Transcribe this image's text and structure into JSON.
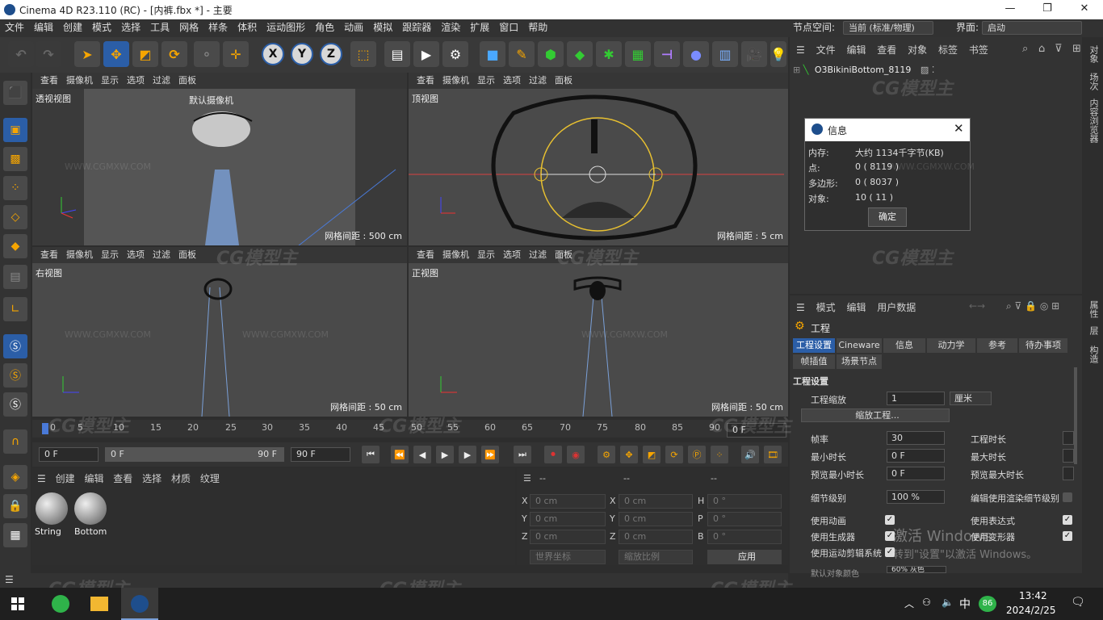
{
  "window": {
    "title": "Cinema 4D R23.110 (RC) - [内裤.fbx *] - 主要"
  },
  "menu": [
    "文件",
    "编辑",
    "创建",
    "模式",
    "选择",
    "工具",
    "网格",
    "样条",
    "体积",
    "运动图形",
    "角色",
    "动画",
    "模拟",
    "跟踪器",
    "渲染",
    "扩展",
    "窗口",
    "帮助"
  ],
  "node_space": {
    "label": "节点空间:",
    "value": "当前 (标准/物理)"
  },
  "layout": {
    "label": "界面:",
    "value": "启动"
  },
  "viewport_menu": [
    "查看",
    "摄像机",
    "显示",
    "选项",
    "过滤",
    "面板"
  ],
  "viewports": {
    "perspective": {
      "name": "透视视图",
      "camera": "默认摄像机",
      "grid": "网格间距 : 500 cm"
    },
    "top": {
      "name": "顶视图",
      "grid": "网格间距 : 5 cm"
    },
    "right": {
      "name": "右视图",
      "grid": "网格间距 : 50 cm"
    },
    "front": {
      "name": "正视图",
      "grid": "网格间距 : 50 cm"
    }
  },
  "timeline": {
    "ticks": [
      "0",
      "5",
      "10",
      "15",
      "20",
      "25",
      "30",
      "35",
      "40",
      "45",
      "50",
      "55",
      "60",
      "65",
      "70",
      "75",
      "80",
      "85",
      "90"
    ],
    "end": "0 F"
  },
  "playback": {
    "current": "0 F",
    "range_start": "0 F",
    "range_end": "90 F",
    "max": "90 F"
  },
  "material_menu": [
    "创建",
    "编辑",
    "查看",
    "选择",
    "材质",
    "纹理"
  ],
  "materials": [
    {
      "name": "String"
    },
    {
      "name": "Bottom"
    }
  ],
  "coords": {
    "dash": "--",
    "rows": [
      [
        "X",
        "0 cm",
        "X",
        "0 cm",
        "H",
        "0 °"
      ],
      [
        "Y",
        "0 cm",
        "Y",
        "0 cm",
        "P",
        "0 °"
      ],
      [
        "Z",
        "0 cm",
        "Z",
        "0 cm",
        "B",
        "0 °"
      ]
    ],
    "world": "世界坐标",
    "scale": "缩放比例",
    "apply": "应用"
  },
  "object_menu": [
    "文件",
    "编辑",
    "查看",
    "对象",
    "标签",
    "书签"
  ],
  "object": {
    "name": "O3BikiniBottom_8119"
  },
  "attr_menu": [
    "模式",
    "编辑",
    "用户数据"
  ],
  "attr": {
    "section": "工程",
    "tabs": [
      "工程设置",
      "Cineware",
      "信息",
      "动力学",
      "参考",
      "待办事项"
    ],
    "tabs2": [
      "帧插值",
      "场景节点"
    ],
    "group": "工程设置",
    "scale_label": "工程缩放",
    "scale_value": "1",
    "scale_unit": "厘米",
    "scale_btn": "缩放工程...",
    "fps_label": "帧率",
    "fps": "30",
    "duration_label": "工程时长",
    "min_label": "最小时长",
    "min": "0 F",
    "max_label": "最大时长",
    "pmin_label": "预览最小时长",
    "pmin": "0 F",
    "pmax_label": "预览最大时长",
    "lod_label": "细节级别",
    "lod": "100 %",
    "lod_render": "编辑使用渲染细节级别",
    "use_anim": "使用动画",
    "use_expr": "使用表达式",
    "use_gen": "使用生成器",
    "use_deform": "使用变形器",
    "use_motion": "使用运动剪辑系统",
    "default_color": "默认对象颜色",
    "default_color_val": "60% 灰色"
  },
  "dialog": {
    "title": "信息",
    "rows": [
      {
        "k": "内存:",
        "v": "大约 1134千字节(KB)"
      },
      {
        "k": "点:",
        "v": "0 ( 8119 )"
      },
      {
        "k": "多边形:",
        "v": "0 ( 8037 )"
      },
      {
        "k": "对象:",
        "v": "10 ( 11 )"
      }
    ],
    "ok": "确定"
  },
  "right_strip": [
    "对象",
    "场次",
    "内容浏览器",
    "属性",
    "层",
    "构造"
  ],
  "activation": {
    "line1": "激活 Windows",
    "line2": "转到\"设置\"以激活 Windows。"
  },
  "watermark": {
    "brand": "CG模型主",
    "url": "WWW.CGMXW.COM"
  },
  "taskbar": {
    "time": "13:42",
    "date": "2024/2/25",
    "ime": "中",
    "badge": "86"
  },
  "colors": {
    "accent": "#2b5ea7",
    "bg": "#2d2d2d",
    "viewport": "#4a4a4a"
  }
}
